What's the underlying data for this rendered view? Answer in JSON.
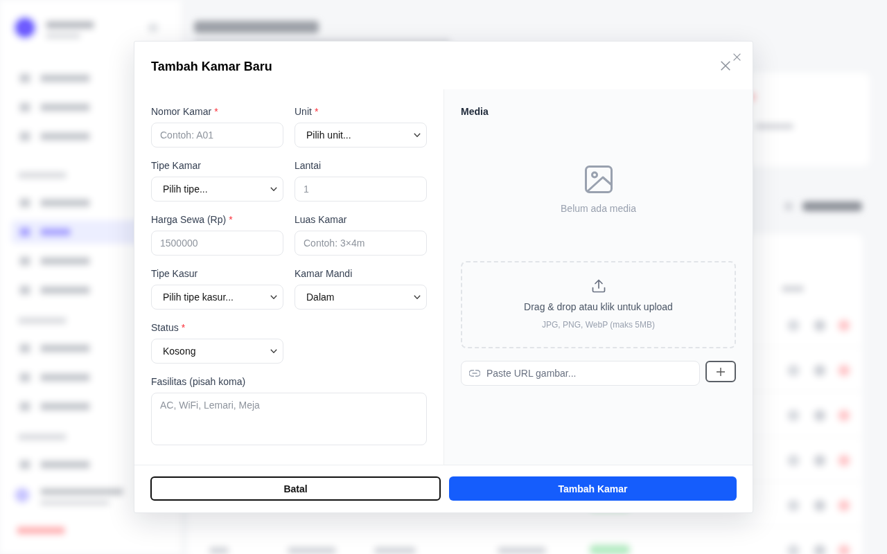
{
  "dialog": {
    "title": "Tambah Kamar Baru"
  },
  "form": {
    "required_mark": "*",
    "fields": [
      {
        "kind": "input",
        "label": "Nomor Kamar",
        "required": true,
        "placeholder": "Contoh: A01"
      },
      {
        "kind": "select",
        "label": "Unit",
        "required": true,
        "value": "Pilih unit..."
      },
      {
        "kind": "select",
        "label": "Tipe Kamar",
        "required": false,
        "value": "Pilih tipe..."
      },
      {
        "kind": "input",
        "label": "Lantai",
        "required": false,
        "placeholder": "1"
      },
      {
        "kind": "input",
        "label": "Harga Sewa (Rp)",
        "required": true,
        "placeholder": "1500000"
      },
      {
        "kind": "input",
        "label": "Luas Kamar",
        "required": false,
        "placeholder": "Contoh: 3×4m"
      },
      {
        "kind": "select",
        "label": "Tipe Kasur",
        "required": false,
        "value": "Pilih tipe kasur..."
      },
      {
        "kind": "select",
        "label": "Kamar Mandi",
        "required": false,
        "value": "Dalam"
      },
      {
        "kind": "select",
        "label": "Status",
        "required": true,
        "value": "Kosong"
      },
      {
        "kind": "textarea",
        "label": "Fasilitas (pisah koma)",
        "required": false,
        "placeholder": "AC, WiFi, Lemari, Meja"
      }
    ]
  },
  "media": {
    "title": "Media",
    "empty_text": "Belum ada media",
    "dropzone": {
      "text": "Drag & drop atau klik untuk upload",
      "hint": "JPG, PNG, WebP (maks 5MB)"
    },
    "url_field": {
      "placeholder": "Paste URL gambar..."
    }
  },
  "buttons": [
    {
      "kind": "secondary",
      "label": "Batal"
    },
    {
      "kind": "primary",
      "label": "Tambah Kamar"
    }
  ]
}
